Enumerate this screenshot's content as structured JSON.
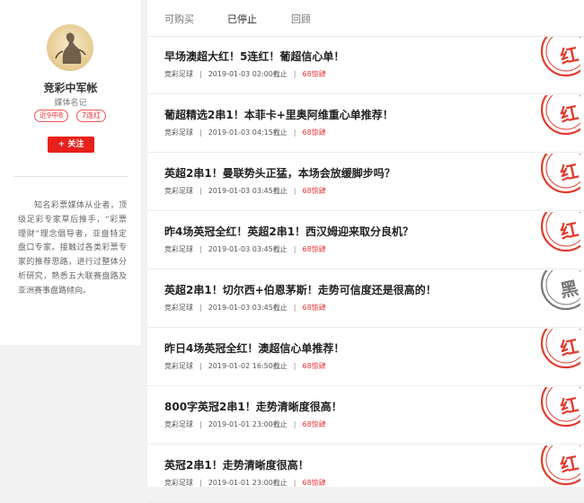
{
  "sidebar": {
    "name": "竞彩中军帐",
    "role": "媒体名记",
    "tags": [
      "近9中8",
      "7连红"
    ],
    "follow_label": "+ 关注",
    "bio": "知名彩票媒体从业者，顶级足彩专家草后推手，“彩票理财”理念倡导者，亚盘特定盘口专家。接触过各类彩票专家的推荐思路，进行过整体分析研究，熟悉五大联赛盘路及亚洲赛事盘路倾向。"
  },
  "tabs": [
    "可购买",
    "已停止",
    "回顾"
  ],
  "active_tab": "已停止",
  "colors": {
    "accent": "#e8201b",
    "stamp_red": "#e23b2e",
    "stamp_black": "#777777"
  },
  "items": [
    {
      "title": "早场澳超大红！5连红！葡超信心单！",
      "category": "竞彩足球",
      "time": "2019-01-03 02:00截止",
      "price": "68惊肆",
      "stamp": "红"
    },
    {
      "title": "葡超精选2串1！本菲卡+里奥阿维重心单推荐！",
      "category": "竞彩足球",
      "time": "2019-01-03 04:15截止",
      "price": "68惊肆",
      "stamp": "红"
    },
    {
      "title": "英超2串1！曼联势头正猛，本场会放缓脚步吗？",
      "category": "竞彩足球",
      "time": "2019-01-03 03:45截止",
      "price": "68惊肆",
      "stamp": "红"
    },
    {
      "title": "昨4场英冠全红！英超2串1！西汉姆迎来取分良机？",
      "category": "竞彩足球",
      "time": "2019-01-03 03:45截止",
      "price": "68惊肆",
      "stamp": "红"
    },
    {
      "title": "英超2串1！切尔西+伯恩茅斯！走势可信度还是很高的！",
      "category": "竞彩足球",
      "time": "2019-01-03 03:45截止",
      "price": "68惊肆",
      "stamp": "黑"
    },
    {
      "title": "昨日4场英冠全红！澳超信心单推荐！",
      "category": "竞彩足球",
      "time": "2019-01-02 16:50截止",
      "price": "68惊肆",
      "stamp": "红"
    },
    {
      "title": "800字英冠2串1！走势清晰度很高！",
      "category": "竞彩足球",
      "time": "2019-01-01 23:00截止",
      "price": "68惊肆",
      "stamp": "红"
    },
    {
      "title": "英冠2串1！走势清晰度很高！",
      "category": "竞彩足球",
      "time": "2019-01-01 23:00截止",
      "price": "68惊肆",
      "stamp": "红"
    }
  ]
}
